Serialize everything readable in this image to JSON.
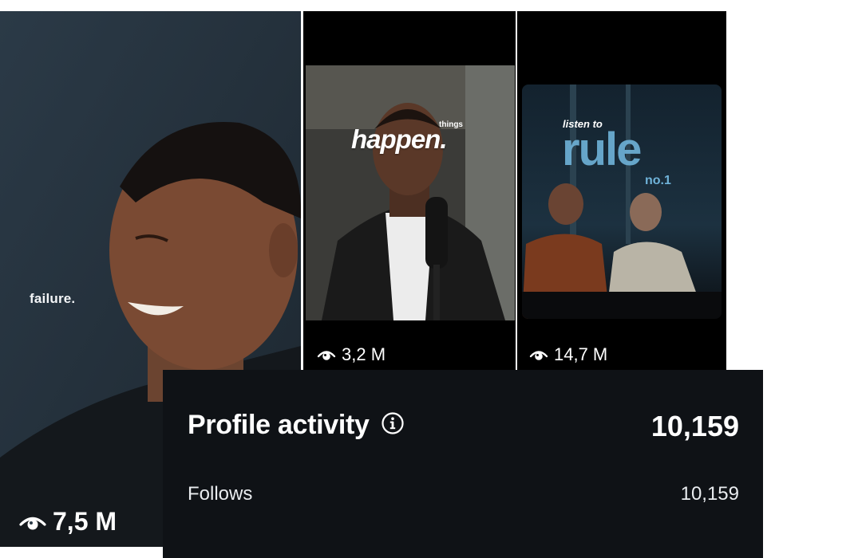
{
  "reels": [
    {
      "overlay_text": "failure.",
      "views": "7,5 M"
    },
    {
      "overlay_small": "things",
      "overlay_big": "happen.",
      "views": "3,2 M"
    },
    {
      "overlay_top": "listen to",
      "overlay_big": "rule",
      "overlay_small": "no.1",
      "views": "14,7 M"
    }
  ],
  "icons": {
    "views": "eye-icon",
    "info": "info-icon"
  },
  "profile_activity": {
    "title": "Profile activity",
    "total": "10,159",
    "rows": [
      {
        "label": "Follows",
        "value": "10,159"
      }
    ]
  }
}
